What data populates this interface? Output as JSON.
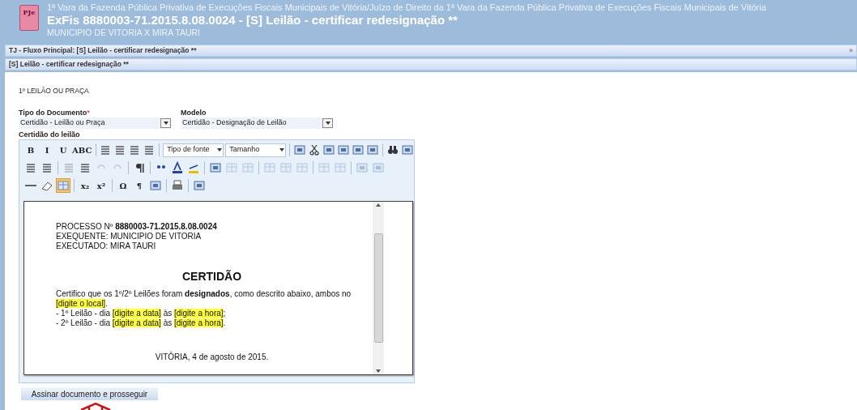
{
  "header": {
    "logo_text": "PJe",
    "court": "1ª Vara da Fazenda Pública Privativa de Execuções Fiscais Municipais de Vitória/Juízo de Direito da 1ª Vara da Fazenda Pública Privativa de Execuções Fiscais Municipais de Vitória",
    "title": "ExFis 8880003-71.2015.8.08.0024 - [S] Leilão - certificar redesignação **",
    "parties": "MUNICIPIO DE VITORIA X MIRA TAURI"
  },
  "flow_bar": {
    "label": "TJ - Fluxo Principal: [S] Leilão - certificar redesignação **",
    "expand": "»"
  },
  "task_bar": {
    "label": "[S] Leilão - certificar redesignação **"
  },
  "section_title": "1º LEILÃO OU PRAÇA",
  "fields": [
    {
      "label": "Tipo do Documento",
      "required_mark": "*",
      "value": "Certidão - Leilão ou Praça"
    },
    {
      "label": "Modelo",
      "value": "Certidão - Designação de Leilão"
    }
  ],
  "editor": {
    "label": "Certidão do leilão",
    "toolbar": [
      [
        {
          "kind": "text",
          "label": "B"
        },
        {
          "kind": "text",
          "label": "I"
        },
        {
          "kind": "text",
          "label": "U"
        },
        {
          "kind": "text",
          "label": "ABC"
        },
        {
          "kind": "sep"
        },
        {
          "kind": "icon",
          "disabled": false
        },
        {
          "kind": "icon",
          "disabled": false
        },
        {
          "kind": "icon",
          "disabled": false
        },
        {
          "kind": "icon",
          "disabled": false
        },
        {
          "kind": "sep"
        },
        {
          "kind": "select",
          "label": "Tipo de fonte"
        },
        {
          "kind": "select",
          "label": "Tamanho"
        },
        {
          "kind": "sep"
        },
        {
          "kind": "icon",
          "disabled": false
        },
        {
          "kind": "icon",
          "disabled": false
        },
        {
          "kind": "icon",
          "disabled": false
        },
        {
          "kind": "icon",
          "disabled": false
        },
        {
          "kind": "icon",
          "disabled": false
        },
        {
          "kind": "icon",
          "disabled": false
        },
        {
          "kind": "sep"
        },
        {
          "kind": "icon",
          "disabled": false
        },
        {
          "kind": "icon",
          "disabled": false
        }
      ],
      [
        {
          "kind": "icon",
          "disabled": false
        },
        {
          "kind": "icon",
          "disabled": false
        },
        {
          "kind": "sep"
        },
        {
          "kind": "icon",
          "disabled": true
        },
        {
          "kind": "icon",
          "disabled": false
        },
        {
          "kind": "icon",
          "disabled": true
        },
        {
          "kind": "icon",
          "disabled": true
        },
        {
          "kind": "sep"
        },
        {
          "kind": "icon",
          "disabled": false
        },
        {
          "kind": "sep"
        },
        {
          "kind": "icon",
          "disabled": false
        },
        {
          "kind": "icon",
          "disabled": false
        },
        {
          "kind": "icon",
          "disabled": false
        },
        {
          "kind": "sep"
        },
        {
          "kind": "icon",
          "disabled": false
        },
        {
          "kind": "icon",
          "disabled": true
        },
        {
          "kind": "icon",
          "disabled": true
        },
        {
          "kind": "sep"
        },
        {
          "kind": "icon",
          "disabled": true
        },
        {
          "kind": "icon",
          "disabled": true
        },
        {
          "kind": "icon",
          "disabled": true
        },
        {
          "kind": "sep"
        },
        {
          "kind": "icon",
          "disabled": true
        },
        {
          "kind": "icon",
          "disabled": true
        },
        {
          "kind": "sep"
        },
        {
          "kind": "icon",
          "disabled": true
        },
        {
          "kind": "icon",
          "disabled": true
        }
      ],
      [
        {
          "kind": "icon",
          "disabled": false
        },
        {
          "kind": "icon",
          "disabled": false
        },
        {
          "kind": "icon",
          "disabled": false,
          "selected": true
        },
        {
          "kind": "sep"
        },
        {
          "kind": "text",
          "label": "x₂"
        },
        {
          "kind": "text",
          "label": "x²"
        },
        {
          "kind": "sep"
        },
        {
          "kind": "text",
          "label": "Ω"
        },
        {
          "kind": "text",
          "label": "¶"
        },
        {
          "kind": "icon",
          "disabled": false
        },
        {
          "kind": "sep"
        },
        {
          "kind": "icon",
          "disabled": false
        },
        {
          "kind": "sep"
        },
        {
          "kind": "icon",
          "disabled": false
        }
      ]
    ],
    "document": {
      "header_lines": [
        "PROCESSO Nº **8880003-71.2015.8.08.0024**",
        "EXEQUENTE: MUNICIPIO DE VITORIA",
        "EXECUTADO: MIRA TAURI"
      ],
      "title": "CERTIDÃO",
      "paragraphs": [
        [
          {
            "text": "Certifico que os 1º/2º Leilões foram **designados**, como descrito abaixo, ambos no ",
            "highlight": false
          },
          {
            "text": "[digite o local]",
            "highlight": true
          },
          {
            "text": ".",
            "highlight": false
          }
        ],
        [
          {
            "text": "- 1º Leilão -  dia ",
            "highlight": false
          },
          {
            "text": "[digite a data]",
            "highlight": true
          },
          {
            "text": " às ",
            "highlight": false
          },
          {
            "text": "[digite a hora]",
            "highlight": true
          },
          {
            "text": ";",
            "highlight": false
          }
        ],
        [
          {
            "text": "- 2º Leilão - dia ",
            "highlight": false
          },
          {
            "text": "[digite a data]",
            "highlight": true
          },
          {
            "text": " às ",
            "highlight": false
          },
          {
            "text": "[digite a hora]",
            "highlight": true
          },
          {
            "text": ".",
            "highlight": false
          }
        ]
      ],
      "closing": "VITÓRIA, 4 de agosto de 2015."
    }
  },
  "submit_button": "Assinar documento e prosseguir"
}
